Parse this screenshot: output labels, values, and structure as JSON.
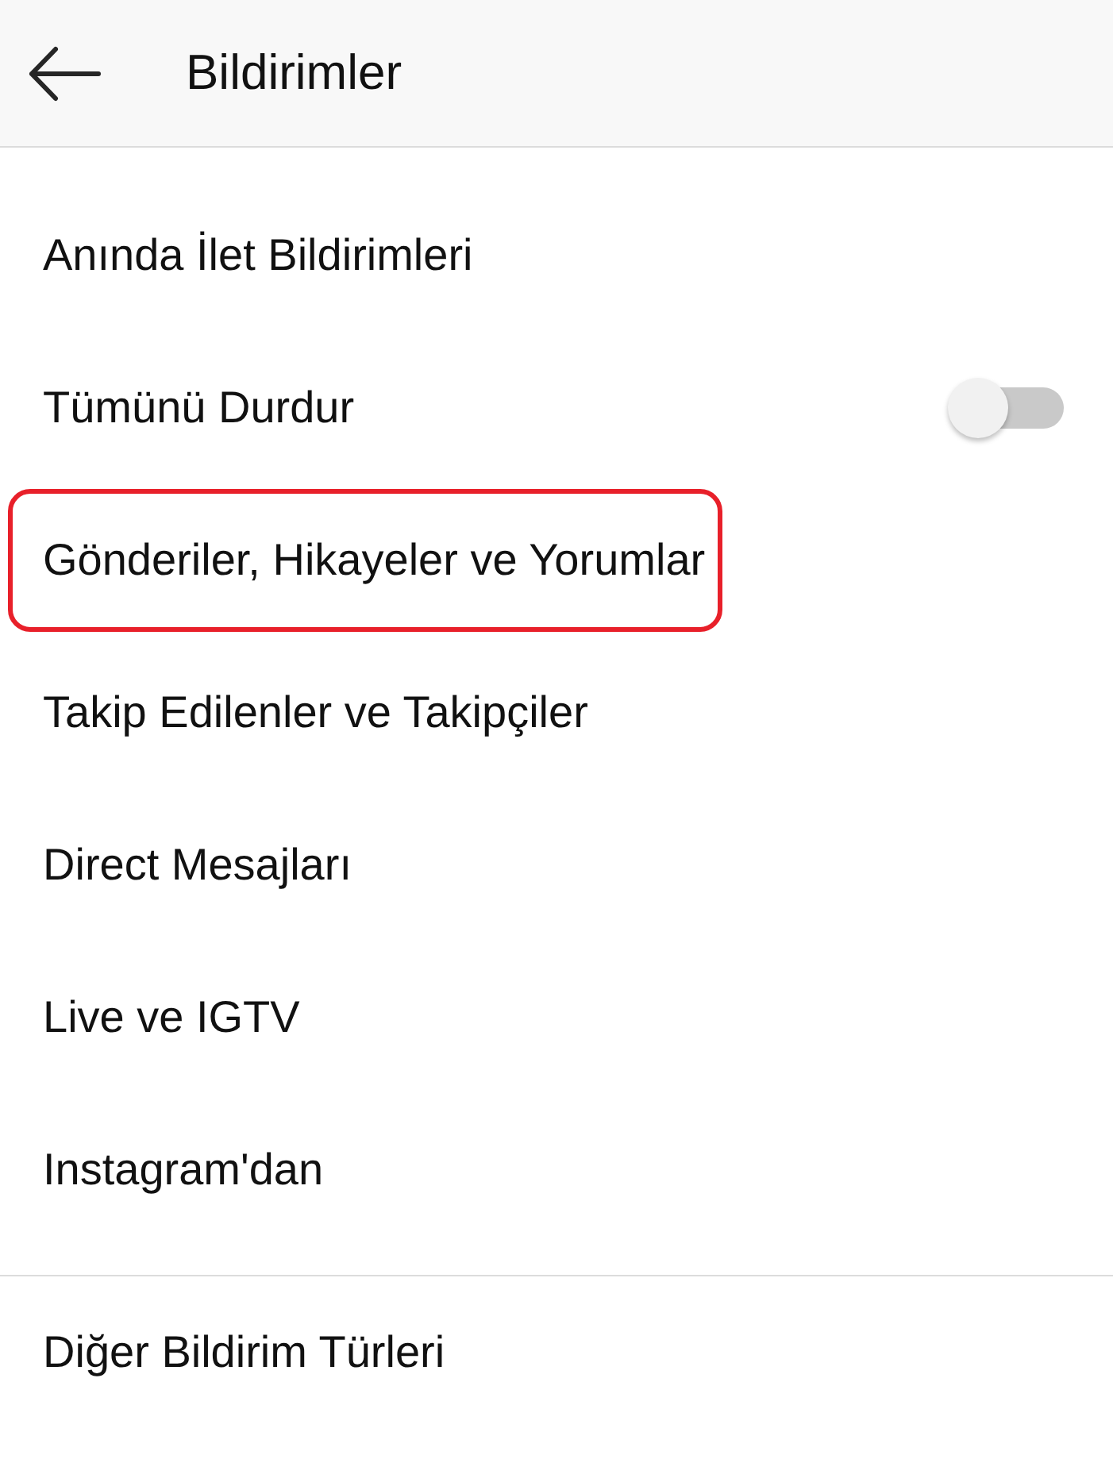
{
  "header": {
    "title": "Bildirimler"
  },
  "sections": [
    {
      "items": [
        {
          "kind": "link",
          "label": "Anında İlet Bildirimleri",
          "highlighted": false
        },
        {
          "kind": "toggle",
          "label": "Tümünü Durdur",
          "on": false,
          "highlighted": false
        },
        {
          "kind": "link",
          "label": "Gönderiler, Hikayeler ve Yorumlar",
          "highlighted": true
        },
        {
          "kind": "link",
          "label": "Takip Edilenler ve Takipçiler",
          "highlighted": false
        },
        {
          "kind": "link",
          "label": "Direct Mesajları",
          "highlighted": false
        },
        {
          "kind": "link",
          "label": "Live ve IGTV",
          "highlighted": false
        },
        {
          "kind": "link",
          "label": "Instagram'dan",
          "highlighted": false
        }
      ]
    },
    {
      "items": [
        {
          "kind": "link",
          "label": "Diğer Bildirim Türleri",
          "highlighted": false
        }
      ]
    }
  ]
}
